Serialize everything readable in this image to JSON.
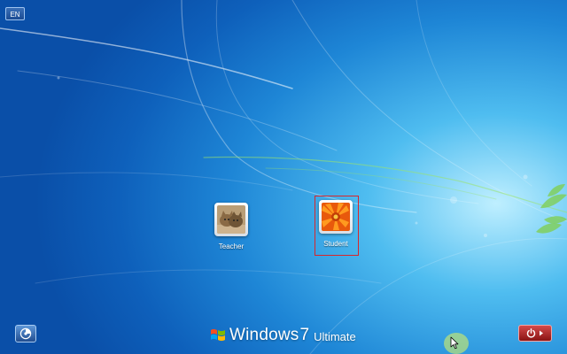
{
  "screen": {
    "name": "Windows 7 logon screen"
  },
  "language": {
    "label": "EN"
  },
  "users": [
    {
      "name": "Teacher",
      "picture": "kittens",
      "selected": false
    },
    {
      "name": "Student",
      "picture": "orange-flower",
      "selected": true
    }
  ],
  "bottom_bar": {
    "ease_of_access_icon": "ease-of-access-icon",
    "brand_word": "Windows",
    "brand_version": "7",
    "brand_edition": "Ultimate",
    "shutdown_icon": "power-icon",
    "shutdown_menu_icon": "chevron-right-icon"
  },
  "colors": {
    "selection_border": "#d8262b",
    "power_button": "#b02828",
    "background": "#1e86d6"
  }
}
